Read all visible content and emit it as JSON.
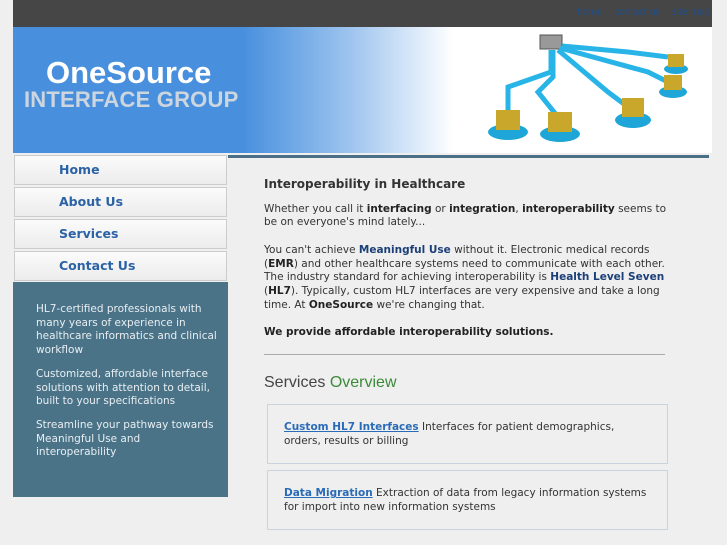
{
  "top_links": [
    "home",
    "contact us",
    "site map"
  ],
  "logo": {
    "line1": "OneSource",
    "line2": "INTERFACE GROUP"
  },
  "nav": [
    "Home",
    "About Us",
    "Services",
    "Contact Us"
  ],
  "sidebar": [
    "HL7-certified professionals with many years of experience in healthcare informatics and clinical workflow",
    "Customized, affordable interface solutions with attention to detail, built to your specifications",
    "Streamline your pathway towards Meaningful Use and interoperability"
  ],
  "main": {
    "title": "Interoperability in Healthcare",
    "p1": {
      "a": "Whether you call it ",
      "b1": "interfacing",
      "c": " or ",
      "b2": "integration",
      "d": ", ",
      "b3": "interoperability",
      "e": " seems to be on everyone's mind lately..."
    },
    "p2": {
      "a": "You can't achieve ",
      "mu": "Meaningful Use",
      "b": " without it. Electronic medical records (",
      "emr": "EMR",
      "c": ") and other healthcare systems need to communicate with each other. The industry standard for achieving interoperability is ",
      "hl": "Health Level Seven",
      "d": " (",
      "hl7": "HL7",
      "e": "). Typically, custom HL7 interfaces are very expensive and take a long time. At ",
      "os": "OneSource",
      "f": " we're changing that."
    },
    "p3": "We provide affordable interoperability solutions.",
    "services_title": "Services",
    "services_title2": "Overview",
    "services": [
      {
        "link": "Custom HL7 Interfaces",
        "text": " Interfaces for patient demographics, orders, results or billing"
      },
      {
        "link": "Data Migration",
        "text": " Extraction of data from legacy information systems for import into new information systems"
      }
    ]
  }
}
